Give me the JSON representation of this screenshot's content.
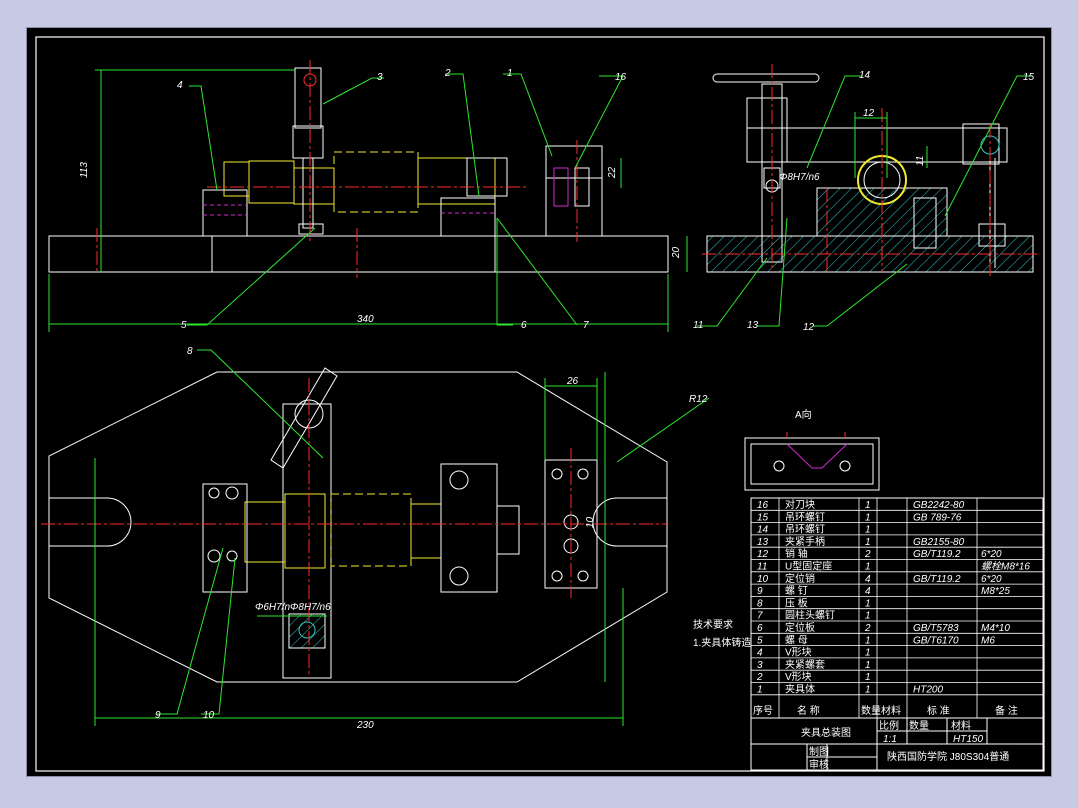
{
  "colors": {
    "background": "#c8c9e4",
    "canvas": "#000000",
    "outline": "#ffffff",
    "dimension": "#2ee62e",
    "thread": "#f2ea2f",
    "center": "#ff2a2a",
    "hatch": "#2ec4c4",
    "hidden": "#d02ad0",
    "leader": "#ffffff"
  },
  "dimensions": {
    "d_113": "113",
    "d_20": "20",
    "d_22": "22",
    "d_340": "340",
    "d_12": "12",
    "d_fit_right": "Φ8H7/n6",
    "d_11": "11",
    "d_26": "26",
    "d_r12": "R12",
    "d_230": "230",
    "d_fit_bottom": "Φ6H7/nΦ8H7/n6",
    "d_10": "10"
  },
  "view_labels": {
    "view_a": "A向"
  },
  "callouts": [
    "1",
    "2",
    "3",
    "4",
    "5",
    "6",
    "7",
    "8",
    "9",
    "10",
    "11",
    "12",
    "13",
    "14",
    "15",
    "16"
  ],
  "tech_notes": {
    "heading": "技术要求",
    "line1": "1.夹具体铸造"
  },
  "bom": {
    "rows": [
      {
        "no": "16",
        "name": "对刀块",
        "qty": "1",
        "std": "GB2242-80",
        "spec": ""
      },
      {
        "no": "15",
        "name": "吊环螺钉",
        "qty": "1",
        "std": "GB 789-76",
        "spec": ""
      },
      {
        "no": "14",
        "name": "吊环螺钉",
        "qty": "1",
        "std": "",
        "spec": ""
      },
      {
        "no": "13",
        "name": "夹紧手柄",
        "qty": "1",
        "std": "GB2155-80",
        "spec": ""
      },
      {
        "no": "12",
        "name": "销 轴",
        "qty": "2",
        "std": "GB/T119.2",
        "spec": "6*20"
      },
      {
        "no": "11",
        "name": "U型固定座",
        "qty": "1",
        "std": "",
        "spec": "螺栓M8*16"
      },
      {
        "no": "10",
        "name": "定位销",
        "qty": "4",
        "std": "GB/T119.2",
        "spec": "6*20"
      },
      {
        "no": "9",
        "name": "螺 钉",
        "qty": "4",
        "std": "",
        "spec": "M8*25"
      },
      {
        "no": "8",
        "name": "压 板",
        "qty": "1",
        "std": "",
        "spec": ""
      },
      {
        "no": "7",
        "name": "圆柱头螺钉",
        "qty": "1",
        "std": "",
        "spec": ""
      },
      {
        "no": "6",
        "name": "定位板",
        "qty": "2",
        "std": "GB/T5783",
        "spec": "M4*10"
      },
      {
        "no": "5",
        "name": "螺 母",
        "qty": "1",
        "std": "GB/T6170",
        "spec": "M6"
      },
      {
        "no": "4",
        "name": "V形块",
        "qty": "1",
        "std": "",
        "spec": ""
      },
      {
        "no": "3",
        "name": "夹紧螺套",
        "qty": "1",
        "std": "",
        "spec": ""
      },
      {
        "no": "2",
        "name": "V形块",
        "qty": "1",
        "std": "",
        "spec": ""
      },
      {
        "no": "1",
        "name": "夹具体",
        "qty": "1",
        "std": "HT200",
        "spec": ""
      }
    ],
    "header": {
      "col_no": "序号",
      "col_name": "名 称",
      "col_qty": "数量",
      "col_mat": "材料",
      "col_std": "标 准",
      "col_note": "备 注"
    }
  },
  "title_block": {
    "drawing_name": "夹具总装图",
    "scale_label": "比例",
    "qty_label": "数量",
    "material_label": "材料",
    "scale": "1:1",
    "material": "HT150",
    "drawn_by": "制图",
    "checked_by": "审核",
    "school": "陕西国防学院 J80S304普通"
  }
}
